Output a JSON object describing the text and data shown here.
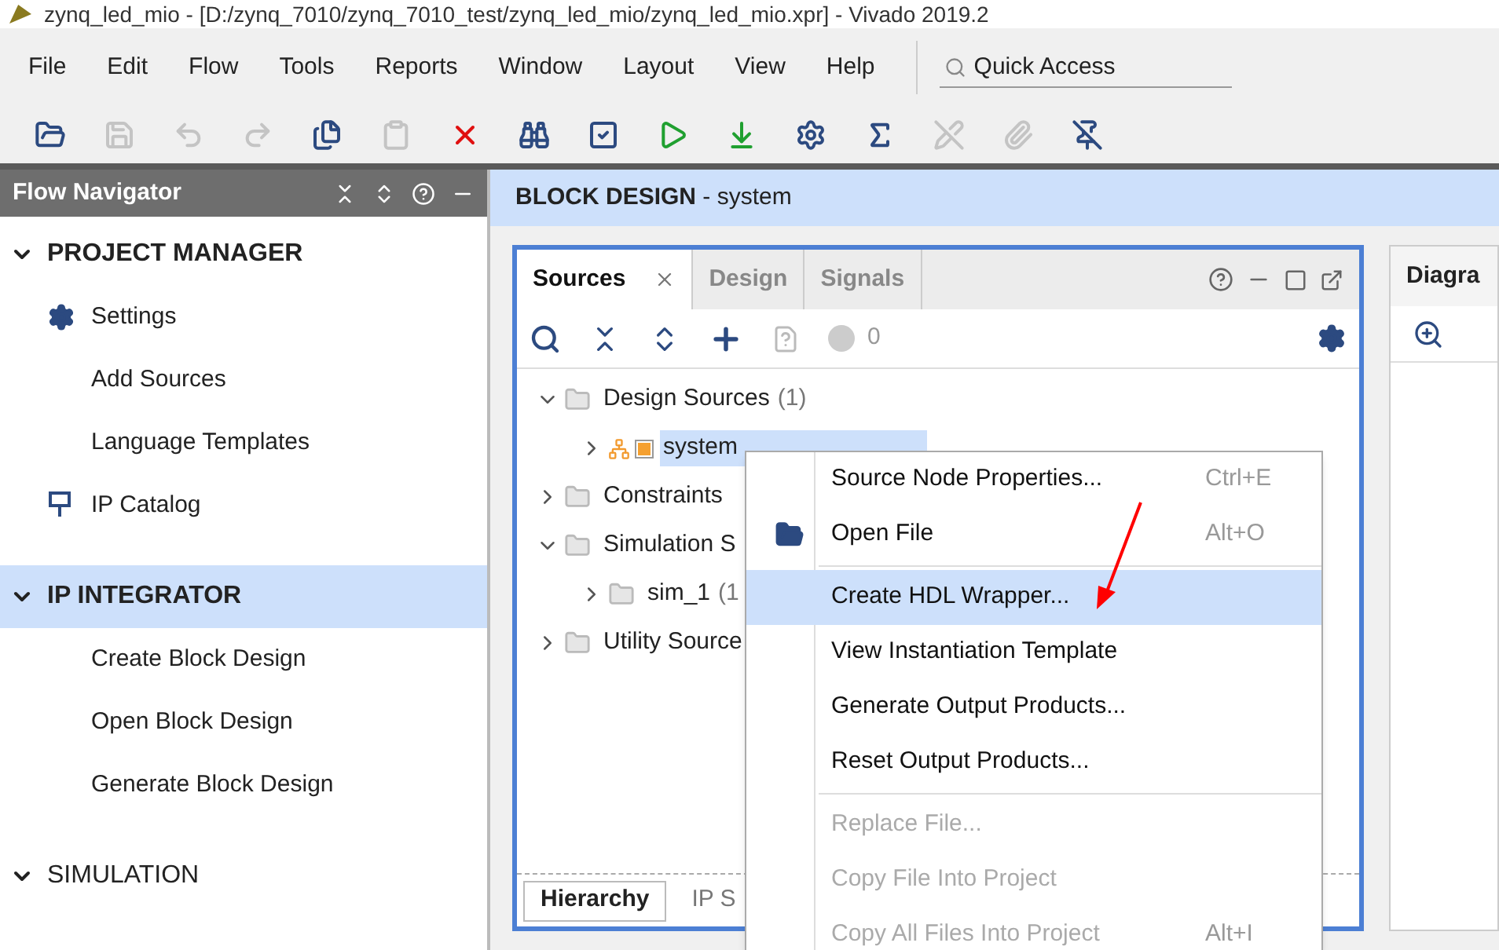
{
  "window": {
    "title": "zynq_led_mio - [D:/zynq_7010/zynq_7010_test/zynq_led_mio/zynq_led_mio.xpr] - Vivado 2019.2"
  },
  "menu": [
    "File",
    "Edit",
    "Flow",
    "Tools",
    "Reports",
    "Window",
    "Layout",
    "View",
    "Help"
  ],
  "quick_access": {
    "placeholder": "Quick Access"
  },
  "flow_navigator": {
    "title": "Flow Navigator",
    "sections": [
      {
        "title": "PROJECT MANAGER",
        "expanded": true,
        "selected": false,
        "items": [
          {
            "label": "Settings",
            "kind": "settings"
          },
          {
            "label": "Add Sources",
            "kind": "link"
          },
          {
            "label": "Language Templates",
            "kind": "link"
          },
          {
            "label": "IP Catalog",
            "kind": "catalog"
          }
        ]
      },
      {
        "title": "IP INTEGRATOR",
        "expanded": true,
        "selected": true,
        "items": [
          {
            "label": "Create Block Design",
            "kind": "link"
          },
          {
            "label": "Open Block Design",
            "kind": "link"
          },
          {
            "label": "Generate Block Design",
            "kind": "link"
          }
        ]
      },
      {
        "title": "SIMULATION",
        "expanded": true,
        "selected": false
      }
    ]
  },
  "block_design": {
    "title": "**BLOCK DESIGN** - system"
  },
  "sources_panel": {
    "tabs": [
      {
        "label": "Sources",
        "selected": true
      },
      {
        "label": "Design",
        "selected": false
      },
      {
        "label": "Signals",
        "selected": false
      }
    ],
    "problem_count": "0",
    "tree": [
      {
        "label": "Design Sources",
        "count": "(1)",
        "expanded": true,
        "selected": false,
        "children": [
          {
            "label": "system",
            "kind": "block",
            "expanded": false,
            "selected": true
          }
        ]
      },
      {
        "label": "Constraints",
        "expanded": false,
        "selected": false
      },
      {
        "label": "Simulation S",
        "expanded": true,
        "selected": false,
        "children": [
          {
            "label": "sim_1",
            "count": "(1",
            "expanded": false,
            "selected": false
          }
        ]
      },
      {
        "label": "Utility Source",
        "expanded": false,
        "selected": false
      }
    ],
    "bottom_tabs": [
      {
        "label": "Hierarchy",
        "selected": true
      },
      {
        "label": "IP S",
        "selected": false
      }
    ]
  },
  "diagram_panel": {
    "title": "Diagra"
  },
  "context_menu": [
    {
      "kind": "item",
      "label": "Source Node Properties...",
      "shortcut": "Ctrl+E",
      "disabled": false,
      "selected": false
    },
    {
      "kind": "icon-item",
      "label": "Open File",
      "shortcut": "Alt+O",
      "disabled": false,
      "selected": false
    },
    {
      "kind": "separator"
    },
    {
      "kind": "item",
      "label": "Create HDL Wrapper...",
      "disabled": false,
      "selected": true
    },
    {
      "kind": "item",
      "label": "View Instantiation Template",
      "disabled": false,
      "selected": false
    },
    {
      "kind": "item",
      "label": "Generate Output Products...",
      "disabled": false,
      "selected": false
    },
    {
      "kind": "item",
      "label": "Reset Output Products...",
      "disabled": false,
      "selected": false
    },
    {
      "kind": "separator"
    },
    {
      "kind": "item",
      "label": "Replace File...",
      "disabled": true,
      "selected": false
    },
    {
      "kind": "item",
      "label": "Copy File Into Project",
      "disabled": true,
      "selected": false
    },
    {
      "kind": "item",
      "label": "Copy All Files Into Project",
      "shortcut": "Alt+I",
      "disabled": true,
      "selected": false
    }
  ]
}
